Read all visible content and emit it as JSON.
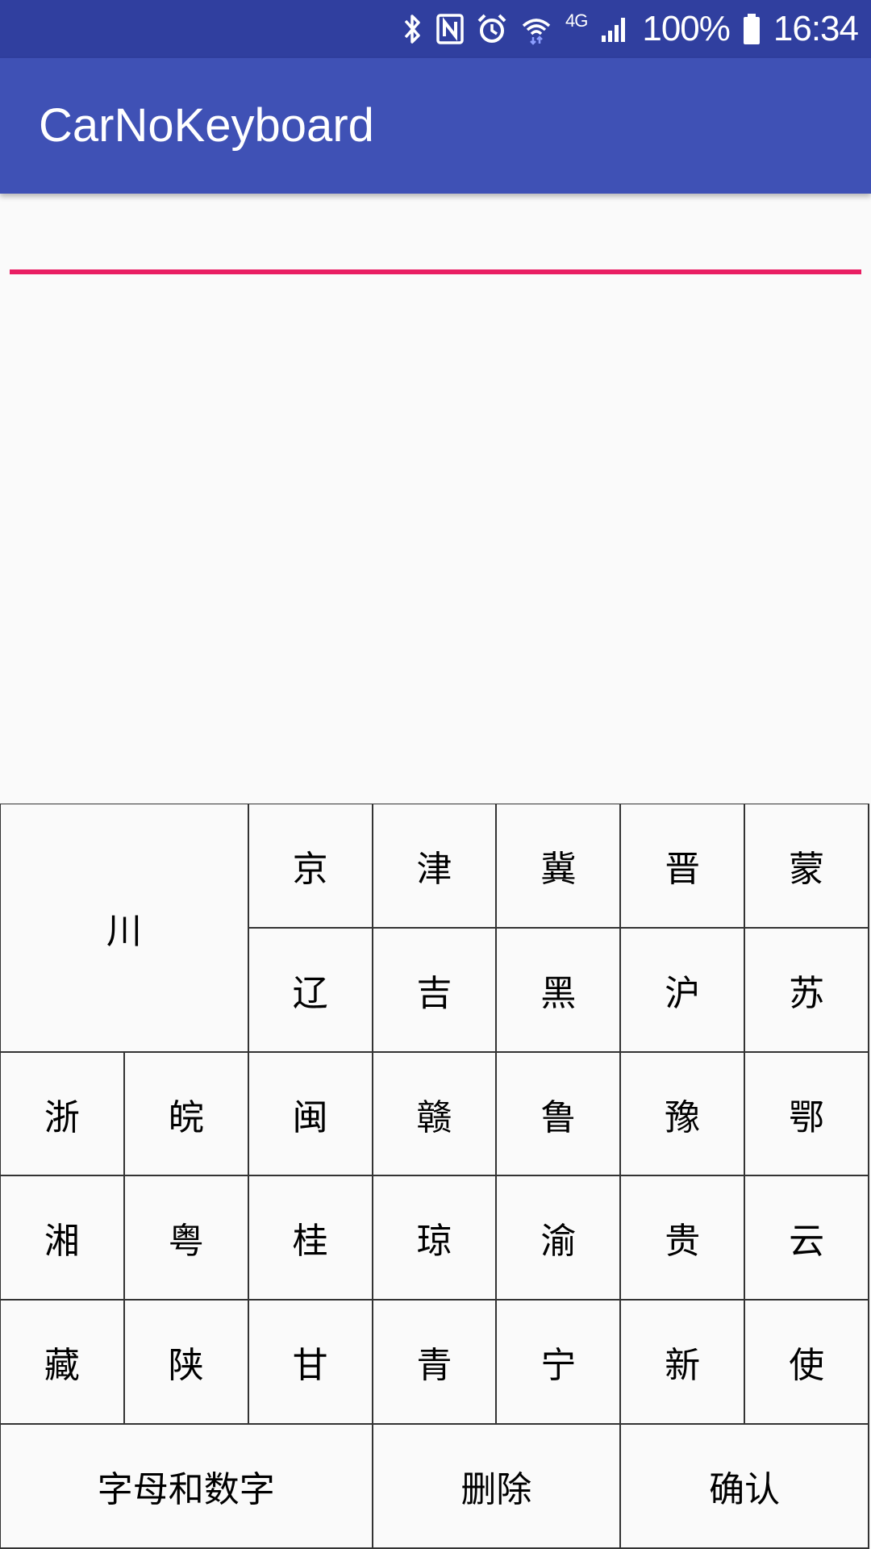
{
  "status_bar": {
    "battery_percent": "100%",
    "time": "16:34",
    "network_type": "4G",
    "icons": [
      "bluetooth-icon",
      "nfc-icon",
      "alarm-icon",
      "wifi-icon",
      "signal-icon",
      "battery-icon"
    ]
  },
  "app_bar": {
    "title": "CarNoKeyboard",
    "color": "#3f51b5",
    "status_color": "#303f9f"
  },
  "input": {
    "value": "",
    "placeholder": "",
    "underline_color": "#e91e63"
  },
  "keyboard": {
    "highlight_key": "川",
    "row1": [
      "京",
      "津",
      "冀",
      "晋",
      "蒙"
    ],
    "row2": [
      "辽",
      "吉",
      "黑",
      "沪",
      "苏"
    ],
    "row3": [
      "浙",
      "皖",
      "闽",
      "赣",
      "鲁",
      "豫",
      "鄂"
    ],
    "row4": [
      "湘",
      "粤",
      "桂",
      "琼",
      "渝",
      "贵",
      "云"
    ],
    "row5": [
      "藏",
      "陕",
      "甘",
      "青",
      "宁",
      "新",
      "使"
    ],
    "bottom": {
      "mode_switch": "字母和数字",
      "delete": "删除",
      "confirm": "确认"
    }
  }
}
